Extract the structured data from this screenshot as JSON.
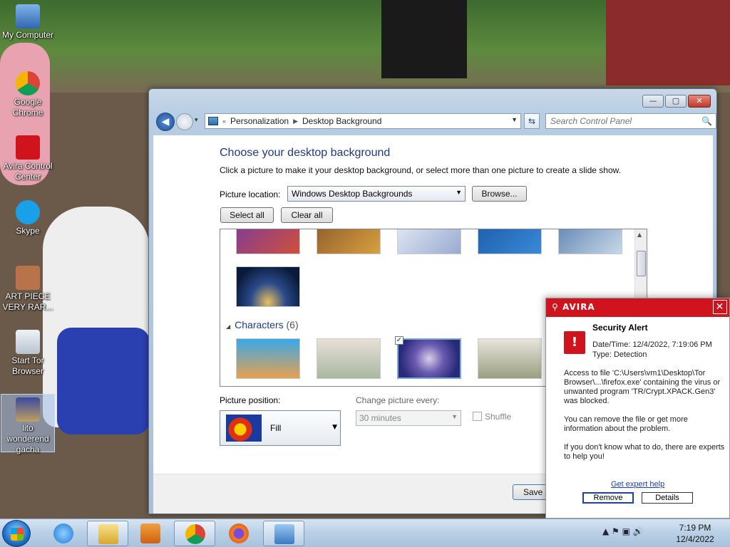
{
  "desktop": {
    "icons": [
      {
        "label": "My Computer"
      },
      {
        "label": "Google Chrome"
      },
      {
        "label": "Avira Control Center"
      },
      {
        "label": "Skype"
      },
      {
        "label": "ART PIECE VERY RAR..."
      },
      {
        "label": "Start Tor Browser"
      },
      {
        "label": "lito wonderend gacha"
      }
    ]
  },
  "window": {
    "controls": {
      "minimize": "—",
      "maximize": "▢",
      "close": "✕"
    },
    "nav": {
      "back": "◀",
      "recent": "▾",
      "refresh": "⇆"
    },
    "breadcrumb": {
      "chevrons": "«",
      "items": [
        "Personalization",
        "Desktop Background"
      ]
    },
    "search": {
      "placeholder": "Search Control Panel",
      "icon": "🔍"
    }
  },
  "panel": {
    "title": "Choose your desktop background",
    "description": "Click a picture to make it your desktop background, or select more than one picture to create a slide show.",
    "location_label": "Picture location:",
    "location_value": "Windows Desktop Backgrounds",
    "browse_label": "Browse...",
    "select_all_label": "Select all",
    "clear_all_label": "Clear all",
    "group": {
      "name": "Characters",
      "count": "(6)"
    },
    "checkmark": "✓",
    "position_label": "Picture position:",
    "position_value": "Fill",
    "change_label": "Change picture every:",
    "change_value": "30 minutes",
    "shuffle_label": "Shuffle",
    "save_label": "Save c"
  },
  "avira": {
    "brand": "AVIRA",
    "close": "✕",
    "title": "Security Alert",
    "datetime": "Date/Time: 12/4/2022, 7:19:06 PM",
    "type": "Type: Detection",
    "message": "Access to file 'C:\\Users\\vm1\\Desktop\\Tor Browser\\...\\firefox.exe' containing the virus or unwanted program 'TR/Crypt.XPACK.Gen3' was blocked.",
    "advice": "You can remove the file or get more information about the problem.",
    "help": "If you don't know what to do, there are experts to help you!",
    "link": "Get expert help",
    "remove_label": "Remove",
    "details_label": "Details",
    "warn_symbol": "!"
  },
  "taskbar": {
    "tray_icons": "▲ ⚑ ▣ 🔊",
    "time": "7:19 PM",
    "date": "12/4/2022"
  },
  "colors": {
    "avira_red": "#d0141e",
    "title_blue": "#1e3a8a"
  }
}
